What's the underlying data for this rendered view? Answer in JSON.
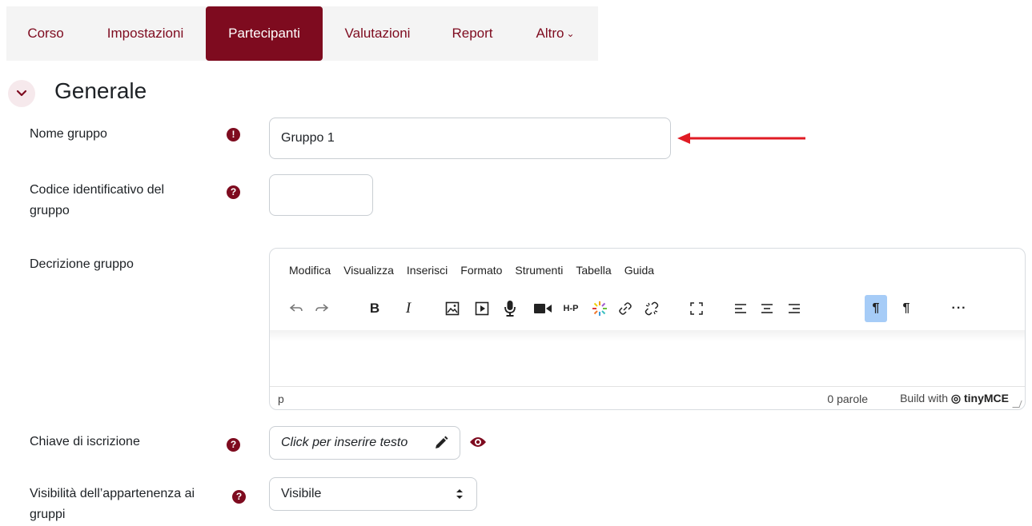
{
  "nav": {
    "items": [
      "Corso",
      "Impostazioni",
      "Partecipanti",
      "Valutazioni",
      "Report",
      "Altro"
    ],
    "active": "Partecipanti"
  },
  "section": {
    "title": "Generale"
  },
  "fields": {
    "group_name": {
      "label": "Nome gruppo",
      "value": "Gruppo 1"
    },
    "group_id": {
      "label_line1": "Codice identificativo del",
      "label_line2": "gruppo",
      "value": ""
    },
    "description": {
      "label": "Decrizione gruppo",
      "menu": [
        "Modifica",
        "Visualizza",
        "Inserisci",
        "Formato",
        "Strumenti",
        "Tabella",
        "Guida"
      ],
      "status_path": "p",
      "word_count": "0 parole",
      "brand_prefix": "Build with",
      "brand_name": "tinyMCE"
    },
    "enrolment_key": {
      "label": "Chiave di iscrizione",
      "placeholder": "Click per inserire testo"
    },
    "visibility": {
      "label_line1": "Visibilità dell’appartenenza ai",
      "label_line2": "gruppi",
      "value": "Visibile"
    }
  },
  "icons": {
    "required": "exclamation-icon",
    "help": "question-icon",
    "reveal": "eye-icon"
  },
  "colors": {
    "brand": "#7e0b1f",
    "nav_bg": "#f4f4f4",
    "annotation_arrow": "#e01b24"
  }
}
